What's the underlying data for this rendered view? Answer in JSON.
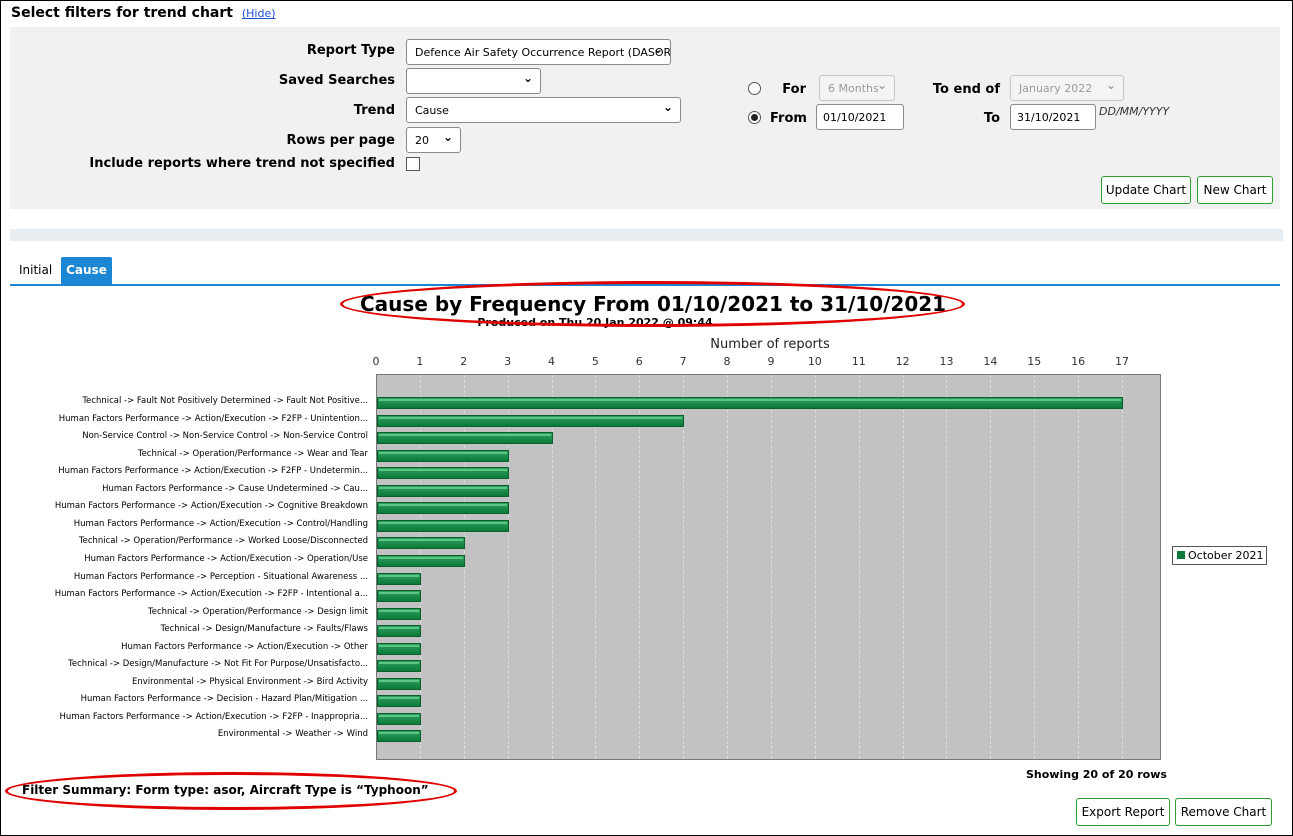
{
  "filters": {
    "title": "Select filters for trend chart",
    "hide_link": "(Hide)",
    "report_type_label": "Report Type",
    "report_type_value": "Defence Air Safety Occurrence Report (DASOR)",
    "saved_searches_label": "Saved Searches",
    "saved_searches_value": "",
    "trend_label": "Trend",
    "trend_value": "Cause",
    "rows_per_page_label": "Rows per page",
    "rows_per_page_value": "20",
    "include_unspecified_label": "Include reports where trend not specified",
    "include_unspecified_checked": false,
    "for_label": "For",
    "for_value": "6 Months",
    "to_end_of_label": "To end of",
    "to_end_of_value": "January 2022",
    "from_label": "From",
    "from_value": "01/10/2021",
    "to_label": "To",
    "to_value": "31/10/2021",
    "date_format_hint": "DD/MM/YYYY",
    "selected_range_mode": "From",
    "update_button": "Update Chart",
    "new_button": "New Chart"
  },
  "tabs": [
    {
      "label": "Initial",
      "active": false
    },
    {
      "label": "Cause",
      "active": true
    }
  ],
  "chart_data": {
    "type": "bar",
    "orientation": "horizontal",
    "title": "Cause by Frequency From 01/10/2021 to 31/10/2021",
    "subtitle": "Produced on Thu 20 Jan 2022 @ 09:44",
    "xlabel": "Number of reports",
    "x_axis_position": "top",
    "xlim": [
      0,
      17
    ],
    "xticks": [
      0,
      1,
      2,
      3,
      4,
      5,
      6,
      7,
      8,
      9,
      10,
      11,
      12,
      13,
      14,
      15,
      16,
      17
    ],
    "grid": true,
    "legend_position": "right",
    "categories": [
      "Technical -> Fault Not Positively Determined -> Fault Not Positive...",
      "Human Factors Performance -> Action/Execution -> F2FP - Unintention...",
      "Non-Service Control -> Non-Service Control -> Non-Service Control",
      "Technical -> Operation/Performance -> Wear and Tear",
      "Human Factors Performance -> Action/Execution -> F2FP - Undetermin...",
      "Human Factors Performance -> Cause Undetermined -> Cau...",
      "Human Factors Performance -> Action/Execution -> Cognitive Breakdown",
      "Human Factors Performance -> Action/Execution -> Control/Handling",
      "Technical -> Operation/Performance -> Worked Loose/Disconnected",
      "Human Factors Performance -> Action/Execution -> Operation/Use",
      "Human Factors Performance -> Perception - Situational Awareness ...",
      "Human Factors Performance -> Action/Execution -> F2FP - Intentional a...",
      "Technical -> Operation/Performance -> Design limit",
      "Technical -> Design/Manufacture -> Faults/Flaws",
      "Human Factors Performance -> Action/Execution -> Other",
      "Technical -> Design/Manufacture -> Not Fit For Purpose/Unsatisfacto...",
      "Environmental -> Physical Environment -> Bird Activity",
      "Human Factors Performance -> Decision - Hazard Plan/Mitigation ...",
      "Human Factors Performance -> Action/Execution -> F2FP - Inappropria...",
      "Environmental -> Weather -> Wind"
    ],
    "series": [
      {
        "name": "October 2021",
        "color": "#0b7a3a",
        "values": [
          17,
          7,
          4,
          3,
          3,
          3,
          3,
          3,
          2,
          2,
          1,
          1,
          1,
          1,
          1,
          1,
          1,
          1,
          1,
          1
        ]
      }
    ]
  },
  "showing_rows": "Showing 20 of 20 rows",
  "filter_summary": "Filter Summary: Form type: asor, Aircraft Type is “Typhoon”",
  "export_button": "Export Report",
  "remove_button": "Remove Chart",
  "colors": {
    "accent": "#1b86d3",
    "button_border": "#2e9e2e",
    "bar": "#0b7a3a",
    "highlight": "#e00000"
  }
}
